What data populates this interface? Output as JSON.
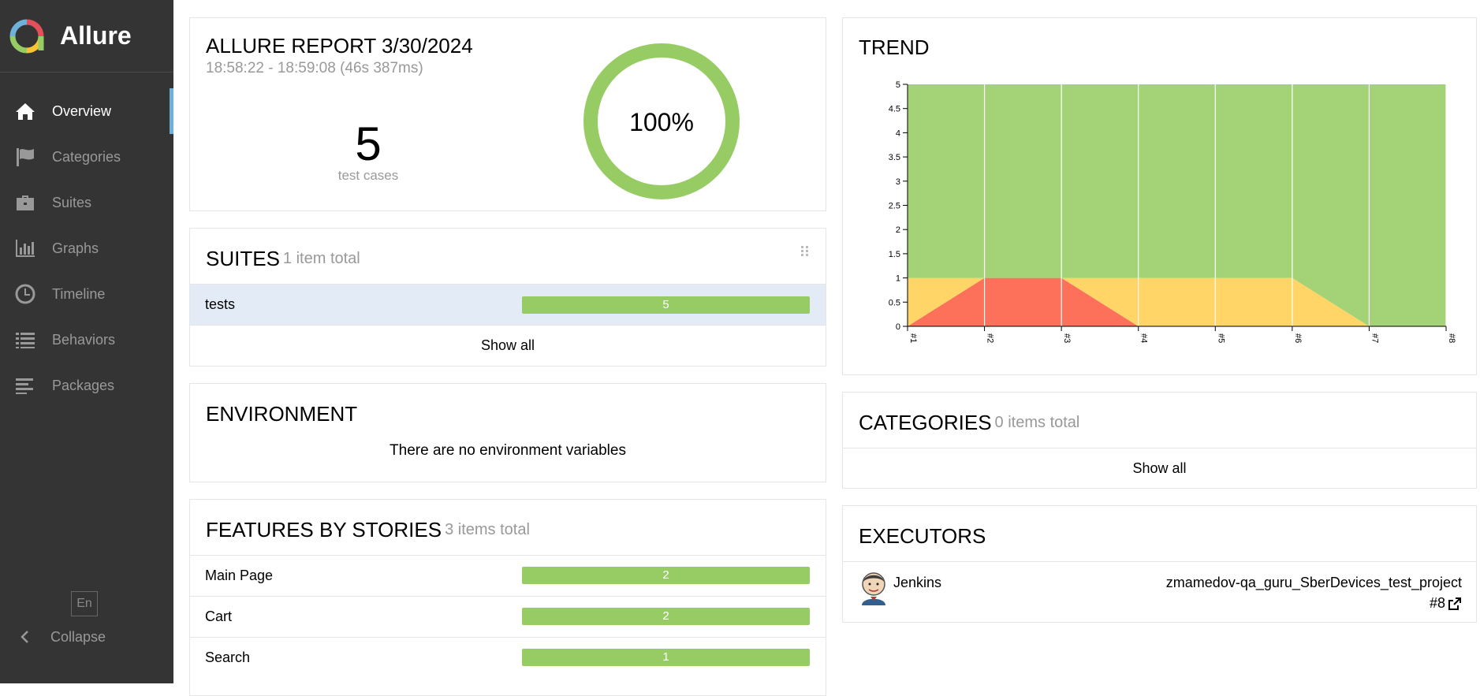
{
  "brand": {
    "name": "Allure"
  },
  "nav": {
    "items": [
      {
        "label": "Overview",
        "icon": "home-icon",
        "active": true
      },
      {
        "label": "Categories",
        "icon": "flag-icon"
      },
      {
        "label": "Suites",
        "icon": "briefcase-icon"
      },
      {
        "label": "Graphs",
        "icon": "bar-chart-icon"
      },
      {
        "label": "Timeline",
        "icon": "clock-icon"
      },
      {
        "label": "Behaviors",
        "icon": "list-icon"
      },
      {
        "label": "Packages",
        "icon": "align-left-icon"
      }
    ],
    "language": "En",
    "collapse_label": "Collapse"
  },
  "summary": {
    "title": "ALLURE REPORT 3/30/2024",
    "time": "18:58:22 - 18:59:08 (46s 387ms)",
    "count": "5",
    "count_label": "test cases",
    "percent": "100%"
  },
  "suites": {
    "title": "SUITES",
    "count": "1 item total",
    "rows": [
      {
        "name": "tests",
        "value": "5"
      }
    ],
    "show_all": "Show all"
  },
  "environment": {
    "title": "ENVIRONMENT",
    "empty": "There are no environment variables"
  },
  "features": {
    "title": "FEATURES BY STORIES",
    "count": "3 items total",
    "rows": [
      {
        "name": "Main Page",
        "value": "2"
      },
      {
        "name": "Cart",
        "value": "2"
      },
      {
        "name": "Search",
        "value": "1"
      }
    ]
  },
  "trend": {
    "title": "TREND",
    "colors": {
      "passed": "#a3d376",
      "broken": "#fed566",
      "failed": "#fd705a"
    }
  },
  "chart_data": {
    "type": "area",
    "x": [
      "#1",
      "#2",
      "#3",
      "#4",
      "#5",
      "#6",
      "#7",
      "#8"
    ],
    "ylim": [
      0,
      5
    ],
    "yticks": [
      "0",
      "0.5",
      "1",
      "1.5",
      "2",
      "2.5",
      "3",
      "3.5",
      "4",
      "4.5",
      "5"
    ],
    "series": [
      {
        "values": [
          0,
          1,
          1,
          0,
          0,
          0,
          0,
          0
        ],
        "color": "#fd705a"
      },
      {
        "values": [
          1,
          0,
          0,
          1,
          1,
          1,
          0,
          0
        ],
        "color": "#fed566"
      },
      {
        "values": [
          4,
          4,
          4,
          4,
          4,
          4,
          5,
          5
        ],
        "color": "#a3d376"
      }
    ]
  },
  "categories": {
    "title": "CATEGORIES",
    "count": "0 items total",
    "show_all": "Show all"
  },
  "executors": {
    "title": "EXECUTORS",
    "name": "Jenkins",
    "project": "zmamedov-qa_guru_SberDevices_test_project",
    "build": "#8"
  }
}
